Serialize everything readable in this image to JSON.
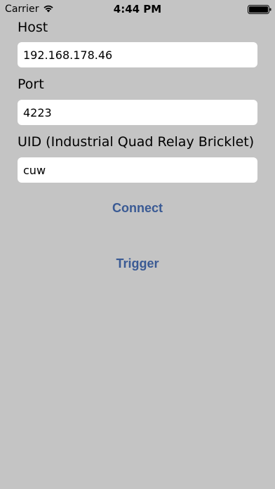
{
  "status_bar": {
    "carrier": "Carrier",
    "time": "4:44 PM",
    "icons": [
      "wifi-icon",
      "battery-icon"
    ]
  },
  "form": {
    "host": {
      "label": "Host",
      "value": "192.168.178.46"
    },
    "port": {
      "label": "Port",
      "value": "4223"
    },
    "uid": {
      "label": "UID (Industrial Quad Relay Bricklet)",
      "value": "cuw"
    }
  },
  "actions": {
    "connect_label": "Connect",
    "trigger_label": "Trigger"
  },
  "colors": {
    "background": "#c4c4c4",
    "accent": "#3a5a94",
    "field_bg": "#ffffff"
  }
}
